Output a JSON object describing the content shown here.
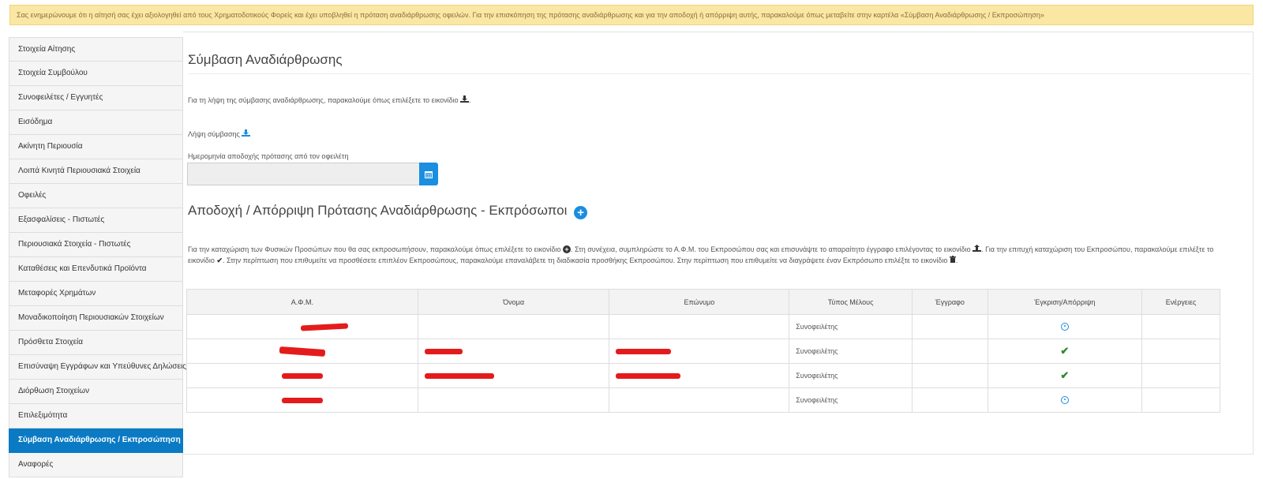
{
  "alert": {
    "text": "Σας ενημερώνουμε ότι η αίτησή σας έχει αξιολογηθεί από τους Χρηματοδοτικούς Φορείς και έχει υποβληθεί η πρόταση αναδιάρθρωσης οφειλών. Για την επισκόπηση της πρότασης αναδιάρθρωσης και για την αποδοχή ή απόρριψη αυτής, παρακαλούμε όπως μεταβείτε στην καρτέλα «Σύμβαση Αναδιάρθρωσης / Εκπροσώπηση»"
  },
  "sidebar": {
    "items": [
      {
        "label": "Στοιχεία Αίτησης"
      },
      {
        "label": "Στοιχεία Συμβούλου"
      },
      {
        "label": "Συνοφειλέτες / Εγγυητές"
      },
      {
        "label": "Εισόδημα"
      },
      {
        "label": "Ακίνητη Περιουσία"
      },
      {
        "label": "Λοιπά Κινητά Περιουσιακά Στοιχεία"
      },
      {
        "label": "Οφειλές"
      },
      {
        "label": "Εξασφαλίσεις - Πιστωτές"
      },
      {
        "label": "Περιουσιακά Στοιχεία - Πιστωτές"
      },
      {
        "label": "Καταθέσεις και Επενδυτικά Προϊόντα"
      },
      {
        "label": "Μεταφορές Χρημάτων"
      },
      {
        "label": "Μοναδικοποίηση Περιουσιακών Στοιχείων"
      },
      {
        "label": "Πρόσθετα Στοιχεία"
      },
      {
        "label": "Επισύναψη Εγγράφων και Υπεύθυνες Δηλώσεις"
      },
      {
        "label": "Διόρθωση Στοιχείων"
      },
      {
        "label": "Επιλεξιμότητα"
      },
      {
        "label": "Σύμβαση Αναδιάρθρωσης / Εκπροσώπηση"
      },
      {
        "label": "Αναφορές"
      }
    ],
    "active_index": 16
  },
  "contract": {
    "title": "Σύμβαση Αναδιάρθρωσης",
    "download_instruction": "Για τη λήψη της σύμβασης αναδιάρθρωσης, παρακαλούμε όπως επιλέξετε το εικονίδιο",
    "download_link": "Λήψη σύμβασης",
    "date_label": "Ημερομηνία αποδοχής πρότασης από τον οφειλέτη",
    "date_value": ""
  },
  "representatives": {
    "title": "Αποδοχή / Απόρριψη Πρότασης Αναδιάρθρωσης - Εκπρόσωποι",
    "instructions": {
      "p1": "Για την καταχώριση των Φυσικών Προσώπων που θα σας εκπροσωπήσουν, παρακαλούμε όπως επιλέξετε το εικονίδιο",
      "p2": ". Στη συνέχεια, συμπληρώστε το Α.Φ.Μ. του Εκπροσώπου σας και επισυνάψτε το απαραίτητο έγγραφο επιλέγοντας το εικονίδιο",
      "p3": ". Για την επιτυχή καταχώριση του Εκπροσώπου, παρακαλούμε επιλέξτε το εικονίδιο",
      "p4": ". Στην περίπτωση που επιθυμείτε να προσθέσετε επιπλέον Εκπροσώπους, παρακαλούμε επαναλάβετε τη διαδικασία προσθήκης Εκπροσώπου. Στην περίπτωση που επιθυμείτε να διαγράψετε έναν Εκπρόσωπο επιλέξτε το εικονίδιο",
      "p5": "."
    },
    "columns": [
      "Α.Φ.Μ.",
      "Όνομα",
      "Επώνυμο",
      "Τύπος Μέλους",
      "Έγγραφο",
      "Έγκριση/Απόρριψη",
      "Ενέργειες"
    ],
    "rows": [
      {
        "member_type": "Συνοφειλέτης",
        "status": "pending-icon"
      },
      {
        "member_type": "Συνοφειλέτης",
        "status": "check-icon"
      },
      {
        "member_type": "Συνοφειλέτης",
        "status": "check-icon"
      },
      {
        "member_type": "Συνοφειλέτης",
        "status": "pending-icon"
      }
    ]
  },
  "colors": {
    "accent": "#1a8ee0",
    "active_tab": "#0a7ac4",
    "alert_bg": "#fbe7a4",
    "approve": "#2e8b2e",
    "redaction": "#e41b1b"
  }
}
